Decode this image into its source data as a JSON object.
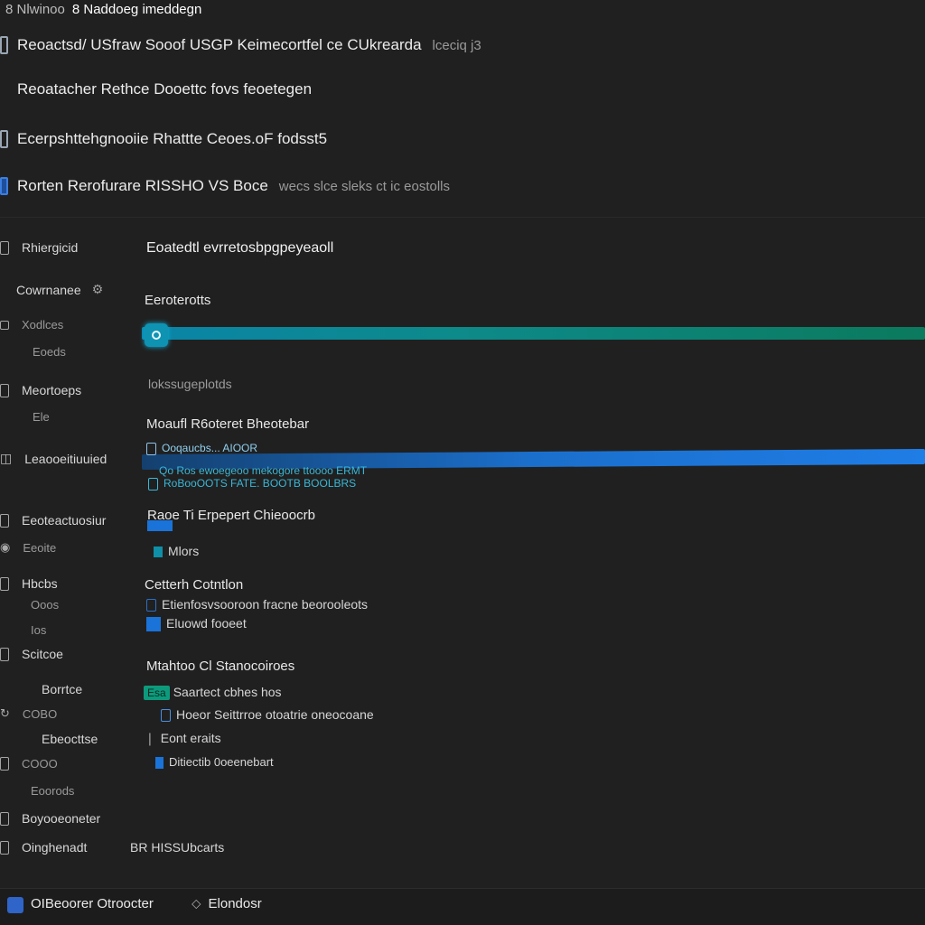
{
  "window": {
    "title_prefix": "8 Nlwinoo",
    "title": "8 Naddoeg imeddegn"
  },
  "header_rows": [
    {
      "label": "Reoactsd/ USfraw Sooof USGP Keimecortfel ce CUkrearda",
      "extra": "lceciq j3"
    },
    {
      "label": "Reoatacher Rethce Dooettc fovs feoetegen",
      "extra": ""
    },
    {
      "label": "Ecerpshttehgnooiie Rhattte Ceoes.oF fodsst5",
      "extra": ""
    },
    {
      "label": "Rorten Rerofurare RISSHO VS Boce",
      "extra": "wecs slce sleks ct ic eostolls"
    }
  ],
  "sidebar": {
    "items": [
      {
        "label": "Rhiergicid",
        "type": "item"
      },
      {
        "label": "Cowrnanee",
        "type": "item"
      },
      {
        "label": "Xodlces",
        "type": "item"
      },
      {
        "label": "Eoeds",
        "type": "sub"
      },
      {
        "label": "Meortoeps",
        "type": "item"
      },
      {
        "label": "Ele",
        "type": "sub"
      },
      {
        "label": "Leaooeitiuuied",
        "type": "item"
      },
      {
        "label": "Eeoteactuosiur",
        "type": "item"
      },
      {
        "label": "Eeoite",
        "type": "sub"
      },
      {
        "label": "Hbcbs",
        "type": "item"
      },
      {
        "label": "Ooos",
        "type": "sub"
      },
      {
        "label": "Ios",
        "type": "sub"
      },
      {
        "label": "Scitcoe",
        "type": "item"
      },
      {
        "label": "Borrtce",
        "type": "item"
      },
      {
        "label": "COBO",
        "type": "sub"
      },
      {
        "label": "Ebeocttse",
        "type": "item"
      },
      {
        "label": "COOO",
        "type": "sub"
      },
      {
        "label": "Eoorods",
        "type": "sub"
      },
      {
        "label": "Boyooeoneter",
        "type": "item"
      },
      {
        "label": "Oinghenadt",
        "type": "item"
      }
    ]
  },
  "main": {
    "title": "Eoatedtl evrretosbpgpeyeaoll",
    "section1": {
      "label": "Eeroterotts",
      "progress": 1.0
    },
    "subtext1": "lokssugeplotds",
    "section2": {
      "label": "Moaufl R6oteret Bheotebar"
    },
    "bar2_label": "Ooqaucbs... AIOOR",
    "link_line": "Qo Ros ewoegeoo mekogore ttoooo ERMT",
    "link_line2": "RoBooOOTS FATE. BOOTB BOOLBRS",
    "section3": {
      "label": "Raoe Ti Erpepert Chieoocrb"
    },
    "section3_item": "Mlors",
    "section4": {
      "label": "Cetterh Cotntlon"
    },
    "section4_items": [
      "Etienfosvsooroon fracne beorooleots",
      "Eluowd fooeet"
    ],
    "section5": {
      "label": "Mtahtoo Cl Stanocoiroes"
    },
    "section5_badge": "Esa",
    "section5_items": [
      "Saartect cbhes hos",
      "Hoeor Seittrroe otoatrie oneocoane",
      "Eont eraits",
      "Ditiectib 0oeenebart"
    ],
    "bottom_right": "BR HISSUbcarts"
  },
  "footer": {
    "items": [
      "OIBeoorer Otroocter",
      "Elondosr"
    ]
  },
  "colors": {
    "background": "#202020",
    "progress_teal": "#0d8a8a",
    "progress_blue": "#1f7de6",
    "accent_blue": "#1a73d9",
    "accent_green": "#0d9a7c"
  }
}
